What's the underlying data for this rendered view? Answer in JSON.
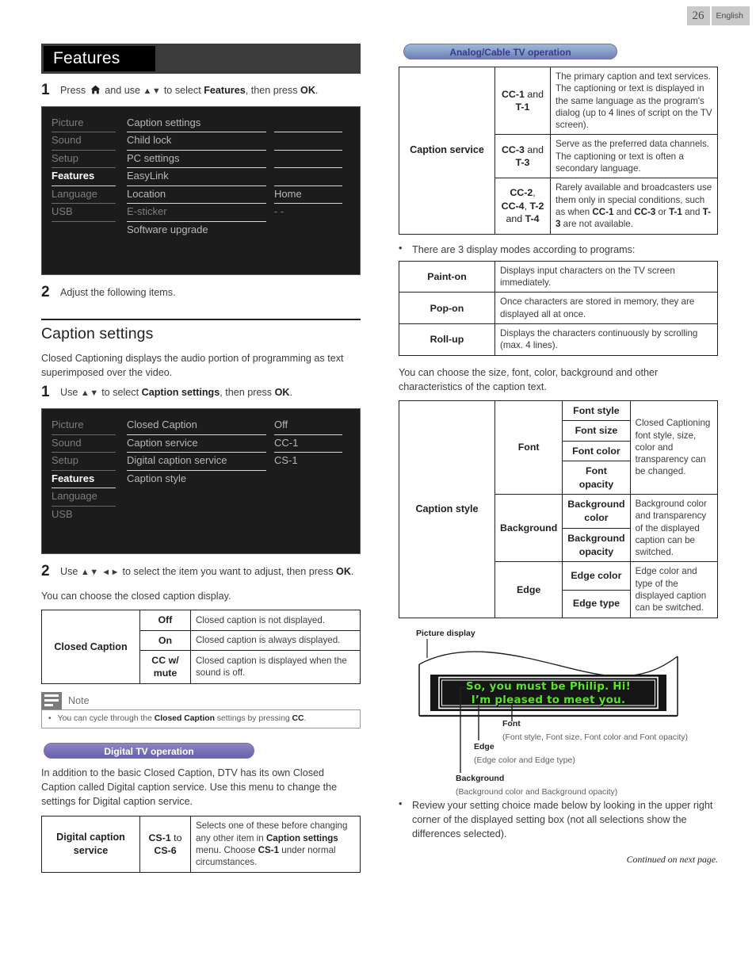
{
  "header": {
    "page_number": "26",
    "language": "English"
  },
  "left": {
    "section_title": "Features",
    "step1": {
      "num": "1",
      "pre": "Press",
      "mid": "and use",
      "arrows": "▲▼",
      "post": "to select",
      "bold1": "Features",
      "tail": ", then press",
      "bold2": "OK",
      "end": "."
    },
    "menu1": {
      "left_items": [
        "Picture",
        "Sound",
        "Setup",
        "Features",
        "Language",
        "USB"
      ],
      "selected_left": "Features",
      "center_items": [
        "Caption settings",
        "Child lock",
        "PC settings",
        "EasyLink",
        "Location",
        "E-sticker",
        "Software upgrade"
      ],
      "right_items": [
        "",
        "",
        "",
        "",
        "Home",
        "- -",
        ""
      ]
    },
    "step2": {
      "num": "2",
      "text": "Adjust the following items."
    },
    "heading": "Caption settings",
    "intro": "Closed Captioning displays the audio portion of programming as text superimposed over the video.",
    "step3": {
      "num": "1",
      "pre": "Use",
      "arrows": "▲▼",
      "post": "to select",
      "bold1": "Caption settings",
      "tail": ", then press",
      "bold2": "OK",
      "end": "."
    },
    "menu2": {
      "left_items": [
        "Picture",
        "Sound",
        "Setup",
        "Features",
        "Language",
        "USB"
      ],
      "selected_left": "Features",
      "center_items": [
        "Closed Caption",
        "Caption service",
        "Digital caption service",
        "Caption style"
      ],
      "right_items": [
        "Off",
        "CC-1",
        "CS-1",
        ""
      ]
    },
    "step4": {
      "num": "2",
      "pre": "Use",
      "arrows": "▲▼ ◄►",
      "post": "to select the item you want to adjust, then press",
      "bold2": "OK",
      "end": "."
    },
    "cc_intro": "You can choose the closed caption display.",
    "cc_table": {
      "label": "Closed Caption",
      "rows": [
        {
          "option": "Off",
          "desc": "Closed caption is not displayed."
        },
        {
          "option": "On",
          "desc": "Closed caption is always displayed."
        },
        {
          "option": "CC w/\nmute",
          "desc": "Closed caption is displayed when the sound is off."
        }
      ]
    },
    "note": {
      "title": "Note",
      "bullet": "•",
      "text_a": "You can cycle through the ",
      "text_b": "Closed Caption",
      "text_c": " settings by pressing ",
      "text_d": "CC",
      "text_e": "."
    },
    "digital_pill": "Digital TV operation",
    "digital_intro": "In addition to the basic Closed Caption, DTV has its own Closed Caption called Digital caption service. Use this menu to change the settings for Digital caption service.",
    "digital_table": {
      "label": "Digital caption\nservice",
      "option_a": "CS-1",
      "option_to": " to ",
      "option_b": "CS-6",
      "desc_1": "Selects one of these before changing any other item in ",
      "desc_bold1": "Caption settings",
      "desc_2": " menu. Choose ",
      "desc_bold2": "CS-1",
      "desc_3": " under normal circumstances."
    }
  },
  "right": {
    "analog_pill": "Analog/Cable TV operation",
    "caption_service_table": {
      "label": "Caption service",
      "rows": [
        {
          "code_parts": [
            {
              "t": "CC-1",
              "b": true
            },
            {
              "t": " and",
              "b": false
            },
            {
              "t": "\n",
              "b": false
            },
            {
              "t": "T-1",
              "b": true
            }
          ],
          "desc": "The primary caption and text services. The captioning or text is displayed in the same language as the program's dialog (up to 4 lines of script on the TV screen)."
        },
        {
          "code_parts": [
            {
              "t": "CC-3",
              "b": true
            },
            {
              "t": " and",
              "b": false
            },
            {
              "t": "\n",
              "b": false
            },
            {
              "t": "T-3",
              "b": true
            }
          ],
          "desc": "Serve as the preferred data channels. The captioning or text is often a secondary language."
        },
        {
          "code_parts": [
            {
              "t": "CC-2",
              "b": true
            },
            {
              "t": ",",
              "b": false
            },
            {
              "t": "\n",
              "b": false
            },
            {
              "t": "CC-4",
              "b": true
            },
            {
              "t": ", ",
              "b": false
            },
            {
              "t": "T-2",
              "b": true
            },
            {
              "t": "\n",
              "b": false
            },
            {
              "t": "and ",
              "b": false
            },
            {
              "t": "T-4",
              "b": true
            }
          ],
          "desc_parts": [
            {
              "t": "Rarely available and broadcasters use them only in special conditions, such as when ",
              "b": false
            },
            {
              "t": "CC-1",
              "b": true
            },
            {
              "t": " and ",
              "b": false
            },
            {
              "t": "CC-3",
              "b": true
            },
            {
              "t": " or ",
              "b": false
            },
            {
              "t": "T-1",
              "b": true
            },
            {
              "t": " and ",
              "b": false
            },
            {
              "t": "T-3",
              "b": true
            },
            {
              "t": " are not available.",
              "b": false
            }
          ]
        }
      ]
    },
    "modes_bullet": "•",
    "modes_intro": "There are 3 display modes according to programs:",
    "modes_table": [
      {
        "name": "Paint-on",
        "desc": "Displays input characters on the TV screen immediately."
      },
      {
        "name": "Pop-on",
        "desc": "Once characters are stored in memory, they are displayed all at once."
      },
      {
        "name": "Roll-up",
        "desc": "Displays the characters continuously by scrolling (max. 4 lines)."
      }
    ],
    "style_intro": "You can choose the size, font, color, background and other characteristics of the caption text.",
    "caption_style_table": {
      "label": "Caption style",
      "groups": [
        {
          "group": "Font",
          "items": [
            "Font style",
            "Font size",
            "Font color",
            "Font opacity"
          ],
          "desc": "Closed Captioning font style, size, color and transparency can be changed."
        },
        {
          "group": "Background",
          "items": [
            "Background\ncolor",
            "Background\nopacity"
          ],
          "desc": "Background color and transparency of the displayed caption can be switched."
        },
        {
          "group": "Edge",
          "items": [
            "Edge color",
            "Edge type"
          ],
          "desc": "Edge color and type of the displayed caption can be switched."
        }
      ]
    },
    "illustration": {
      "picture_display": "Picture display",
      "caption_line1": "So, you must be Philip. Hi!",
      "caption_line2": "I’m pleased to meet you.",
      "caption_color": "#58e427",
      "font_label": "Font",
      "font_sub": "(Font style, Font size, Font color and Font opacity)",
      "edge_label": "Edge",
      "edge_sub": "(Edge color and Edge type)",
      "background_label": "Background",
      "background_sub": "(Background color and Background opacity)"
    },
    "review_bullet": "•",
    "review_text": "Review your setting choice made below by looking in the upper right corner of the displayed setting box (not all selections show the differences selected).",
    "continued": "Continued on next page."
  }
}
